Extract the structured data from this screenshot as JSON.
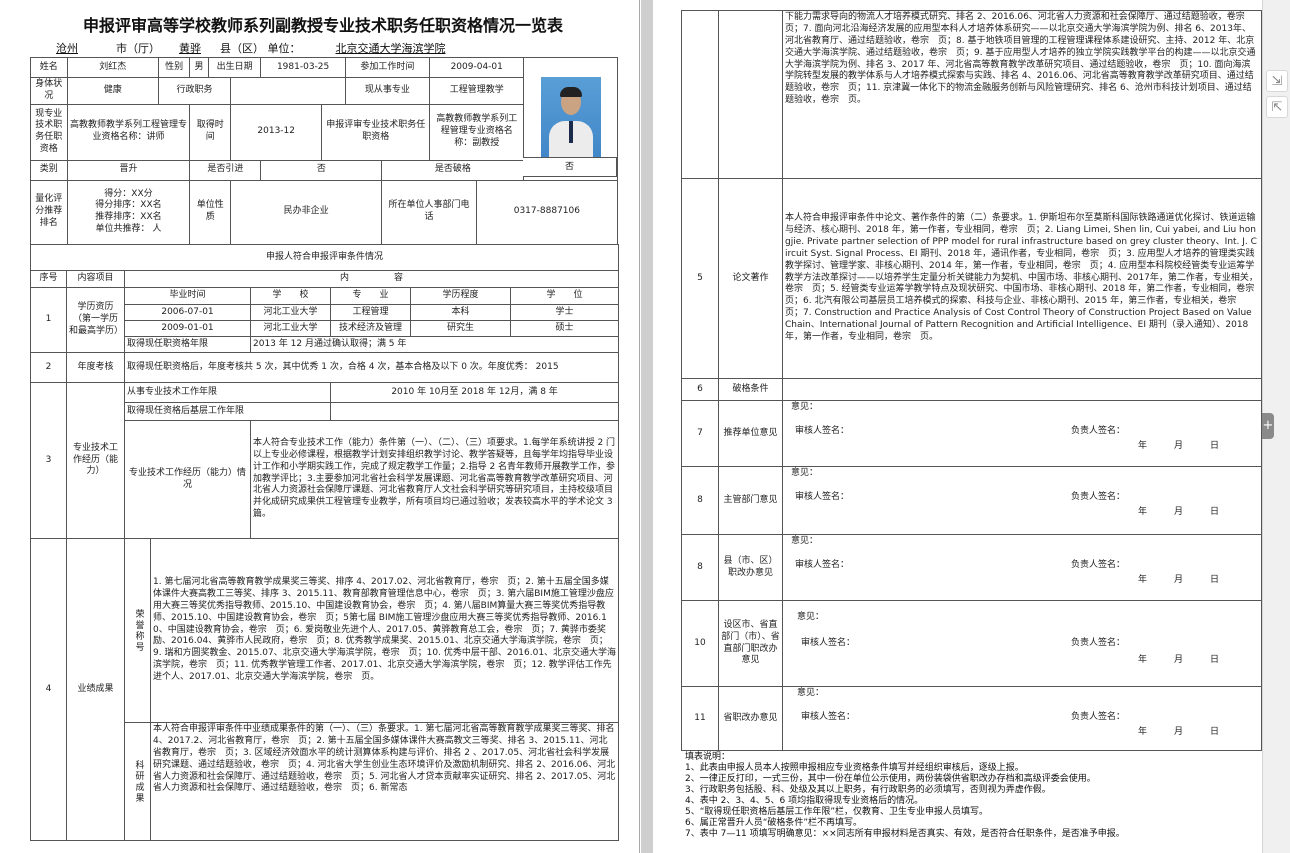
{
  "doc": {
    "title": "申报评审高等学校教师系列副教授专业技术职务任职资格情况一览表",
    "header": {
      "city": "沧州",
      "city_suffix": "市（厅）",
      "county": "黄骅",
      "county_suffix": "县（区）",
      "unit_label": "单位：",
      "unit": "北京交通大学海滨学院"
    }
  },
  "basic": {
    "name_label": "姓名",
    "name": "刘红杰",
    "gender_label": "性别",
    "gender": "男",
    "dob_label": "出生日期",
    "dob": "1981-03-25",
    "work_start_label": "参加工作时间",
    "work_start": "2009-04-01",
    "health_label": "身体状况",
    "health": "健康",
    "admin_label": "行政职务",
    "admin": "",
    "current_job_label": "现从事专业",
    "current_job": "工程管理教学",
    "cur_title_label": "现专业技术职务任职资格",
    "cur_title": "高教教师教学系列工程管理专业资格名称：讲师",
    "obtain_label": "取得时间",
    "obtain": "2013-12",
    "apply_label": "申报评审专业技术职务任职资格",
    "apply": "高教教师教学系列工程管理专业资格名称：副教授",
    "category_label": "类别",
    "category": "晋升",
    "intro_label": "是否引进",
    "intro": "否",
    "exception_label": "是否破格",
    "exception": "否",
    "score_label": "量化评分推荐排名",
    "score": "得分：XX分",
    "score_rank": "得分排序：XX名",
    "rec_rank": "推荐排序：XX名",
    "unit_total": "单位共推荐：  人",
    "unit_nature_label": "单位性质",
    "unit_nature": "民办非企业",
    "phone_label": "所在单位人事部门电话",
    "phone": "0317-8887106"
  },
  "cond": {
    "heading": "申报人符合申报评审条件情况",
    "seq": "序号",
    "item": "内容项目",
    "content": "内　　　　　容"
  },
  "edu": {
    "label": "学历资历（第一学历和最高学历）",
    "h1": "毕业时间",
    "h2": "学　　校",
    "h3": "专　　业",
    "h4": "学历程度",
    "h5": "学　　位",
    "r1": [
      "2006-07-01",
      "河北工业大学",
      "工程管理",
      "本科",
      "学士"
    ],
    "r2": [
      "2009-01-01",
      "河北工业大学",
      "技术经济及管理",
      "研究生",
      "硕士"
    ],
    "cert_label": "取得现任职资格年限",
    "cert": "2013 年 12 月通过确认取得；满 5 年"
  },
  "annual": {
    "label": "年度考核",
    "text": "取得现任职资格后，年度考核共 5 次，其中优秀 1 次，合格 4 次，基本合格及以下 0 次。年度优秀：  2015"
  },
  "exp": {
    "label": "专业技术工作经历（能力）",
    "years_label": "从事专业技术工作年限",
    "years": "2010 年 10月至 2018 年 12月，满 8 年",
    "grass_label": "取得现任资格后基层工作年限",
    "sub_label": "专业技术工作经历（能力）情况",
    "text": "本人符合专业技术工作（能力）条件第（一）、（二）、（三）项要求。1.每学年系统讲授 2 门以上专业必修课程，根据教学计划安排组织教学讨论、教学答疑等，且每学年均指导毕业设计工作和小学期实践工作，完成了规定教学工作量；2.指导 2 名青年教师开展教学工作，参加教学评比；3.主要参加河北省社会科学发展课题、河北省高等教育教学改革研究项目、河北省人力资源社会保障厅课题、河北省教育厅人文社会科学研究等研究项目，主持校级项目并化成研究成果供工程管理专业教学，所有项目均已通过验收；发表较高水平的学术论文 3 篇。"
  },
  "achv": {
    "label": "业绩成果",
    "honor_label": "荣誉称号",
    "honor": "1. 第七届河北省高等教育教学成果奖三等奖、排序 4、2017.02、河北省教育厅，卷宗　页；2. 第十五届全国多媒体课件大赛高教工三等奖、排序 3、2015.11、教育部教育管理信息中心，卷宗　页；3. 第六届BIM施工管理沙盘应用大赛三等奖优秀指导教师、2015.10、中国建设教育协会，卷宗　页；4. 第八届BIM算量大赛三等奖优秀指导教师、2015.10、中国建设教育协会，卷宗　页；5第七届 BIM施工管理沙盘应用大赛三等奖优秀指导教师、2016.10、中国建设教育协会，卷宗　页；6. 爱岗敬业先进个人、2017.05、黄骅教育总工会，卷宗　页；7. 黄骅市委奖励、2016.04、黄骅市人民政府，卷宗　页；8. 优秀教学成果奖、2015.01、北京交通大学海滨学院，卷宗　页；9. 瑞和方圆奖教金、2015.07、北京交通大学海滨学院，卷宗　页；10. 优秀中层干部、2016.01、北京交通大学海滨学院，卷宗　页；11. 优秀教学管理工作者、2017.01、北京交通大学海滨学院，卷宗　页；12. 教学评估工作先进个人、2017.01、北京交通大学海滨学院，卷宗　页。",
    "research_label": "科研成果",
    "research": "本人符合申报评审条件中业绩成果条件的第（一）、（三）条要求。1. 第七届河北省高等教育教学成果奖三等奖、排名 4、2017.2、河北省教育厅，卷宗　页；2. 第十五届全国多媒体课件大赛高教文三等奖、排名 3、2015.11、河北省教育厅，卷宗　页；3. 区域经济效面水平的统计测算体系构建与评价、排名 2 、2017.05、河北省社会科学发展研究课题、通过结题验收，卷宗　页；4. 河北省大学生创业生态环境评价及激励机制研究、排名 2、2016.06、河北省人力资源和社会保障厅、通过结题验收，卷宗　页；5. 河北省人才贷本贡献率实证研究、排名 2、2017.05、河北省人力资源和社会保障厅、通过结题验收，卷宗　页；6. 新常态",
    "cont": "下能力需求导向的物流人才培养模式研究、排名 2、2016.06、河北省人力资源和社会保障厅、通过结题验收，卷宗　页；7. 面向河北沿海经济发展的应用型本科人才培养体系研究——以北京交通大学海滨学院为例、排名 6、2013年、河北省教育厅、通过结题验收，卷宗　页；8. 基于地铁项目管理的工程管理课程体系建设研究、主持、2012 年、北京交通大学海滨学院、通过结题验收，卷宗　页；9. 基于应用型人才培养的独立学院实践教学平台的构建——以北京交通大学海滨学院为例、排名 3、2017 年、河北省高等教育教学改革研究项目、通过结题验收，卷宗　页；10. 面向海滨学院转型发展的教学体系与人才培养模式探索与实践、排名 4、2016.06、河北省高等教育教学改革研究项目、通过结题验收，卷宗　页；11. 京津冀一体化下的物流金融服务创新与风险管理研究、排名 6、沧州市科技计划项目、通过结题验收，卷宗　页。"
  },
  "paper": {
    "num": "5",
    "label": "论文著作",
    "text": "本人符合申报评审条件中论文、著作条件的第（二）条要求。1. 伊斯坦布尔至莫斯科国际铁路通道优化探讨、铁道运输与经济、核心期刊、2018 年，第一作者，专业相同，卷宗　页；2. Liang Limei, Shen lin, Cui yabei, and Liu hongjie. Private partner selection of PPP model for rural infrastructure based on grey cluster theory、Int. J. Circuit Syst. Signal Process、EI 期刊、2018 年，通讯作者，专业相同，卷宗　页；3. 应用型人才培养的管理类实践教学探讨、管理学家、非核心期刊、2014 年，第一作者，专业相同，卷宗　页；4. 应用型本科院校经管类专业运筹学教学方法改革探讨——以培养学生定量分析关键能力为契机、中国市场、非核心期刊、2017年，第二作者，专业相关，卷宗　页；5. 经管类专业运筹学教学特点及现状研究、中国市场、非核心期刊、2018 年，第二作者，专业相同，卷宗　页；6. 北汽有限公司基层员工培养模式的探索、科技与企业、非核心期刊、2015 年，第三作者，专业相关，卷宗　页；7. Construction and Practice Analysis of Cost Control Theory of Construction Project Based on Value Chain、International Journal of Pattern Recognition and Artificial Intelligence、EI 期刊（录入通知）、2018 年，第一作者，专业相同，卷宗　页。"
  },
  "row6": {
    "num": "6",
    "label": "破格条件"
  },
  "opinions": [
    {
      "num": "7",
      "label": "推荐单位意见",
      "op": "意见：",
      "rev": "审核人签名：",
      "head": "负责人签名：",
      "date": "年　　　月　　　日"
    },
    {
      "num": "8",
      "label": "主管部门意见",
      "op": "意见：",
      "rev": "审核人签名：",
      "head": "负责人签名：",
      "date": "年　　　月　　　日"
    },
    {
      "num": "8",
      "label": "县（市、区）职改办意见",
      "op": "意见：",
      "rev": "审核人签名：",
      "head": "负责人签名：",
      "date": "年　　　月　　　日"
    },
    {
      "num": "10",
      "label": "设区市、省直部门（市）、省直部门职改办意见",
      "op": "意见：",
      "rev": "审核人签名：",
      "head": "负责人签名：",
      "date": "年　　　月　　　日"
    },
    {
      "num": "11",
      "label": "省职改办意见",
      "op": "意见：",
      "rev": "审核人签名：",
      "head": "负责人签名：",
      "date": "年　　　月　　　日"
    }
  ],
  "notes": [
    "填表说明：",
    "1、此表由申报人员本人按照申报相应专业资格条件填写并经组织审核后，逐级上报。",
    "2、一律正反打印，一式三份，其中一份在单位公示使用，两份装袋供省职改办存档和高级评委会使用。",
    "3、行政职务包括股、科、处级及其以上职务，有行政职务的必须填写，否则视为弄虚作假。",
    "4、表中 2、3、4、5、6 项均指取得现专业资格后的情况。",
    "5、“取得现任职资格后基层工作年限”栏，仅教育、卫生专业申报人员填写。",
    "6、属正常晋升人员“破格条件”栏不再填写。",
    "7、表中 7—11 项填写明确意见：××同志所有申报材料是否真实、有效，是否符合任职条件，是否准予申报。"
  ]
}
